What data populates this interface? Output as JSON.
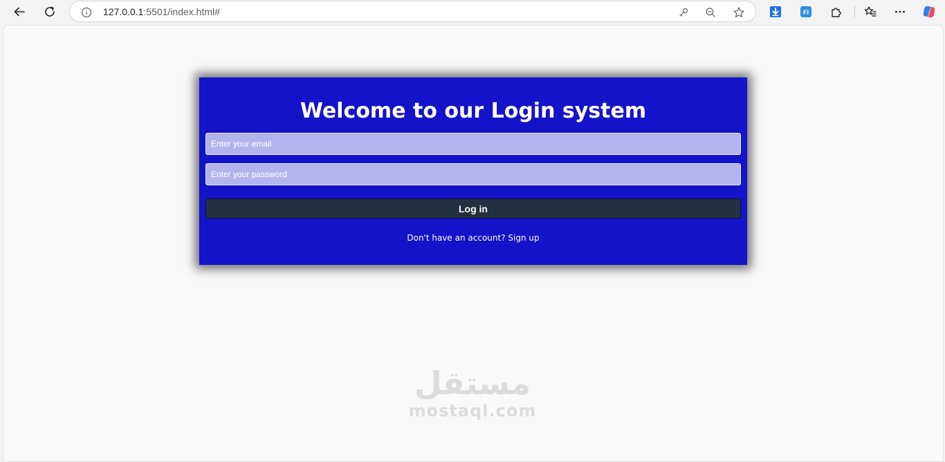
{
  "browser": {
    "url_host": "127.0.0.1",
    "url_rest": ":5501/index.html#",
    "icons": {
      "back": "back-arrow-icon",
      "reload": "reload-icon",
      "site_info": "info-icon",
      "password": "key-icon",
      "zoom": "zoom-out-icon",
      "favorite": "star-icon",
      "download": "download-icon",
      "extension_fi": "fi-extension-icon",
      "extensions": "puzzle-icon",
      "favorites": "favorites-list-icon",
      "more": "more-icon",
      "copilot": "copilot-icon"
    },
    "extension_fi_label": "FI"
  },
  "login": {
    "title": "Welcome to our Login system",
    "email_placeholder": "Enter your email",
    "password_placeholder": "Enter your password",
    "button_label": "Log in",
    "signup_prompt": "Don't have an account?",
    "signup_link": "Sign up"
  },
  "watermark": {
    "arabic": "مستقل",
    "latin": "mostaql.com"
  },
  "colors": {
    "card_background": "#1313c9",
    "input_background": "#b4b4ec",
    "button_background": "#233040",
    "page_background": "#f9f9f9"
  }
}
